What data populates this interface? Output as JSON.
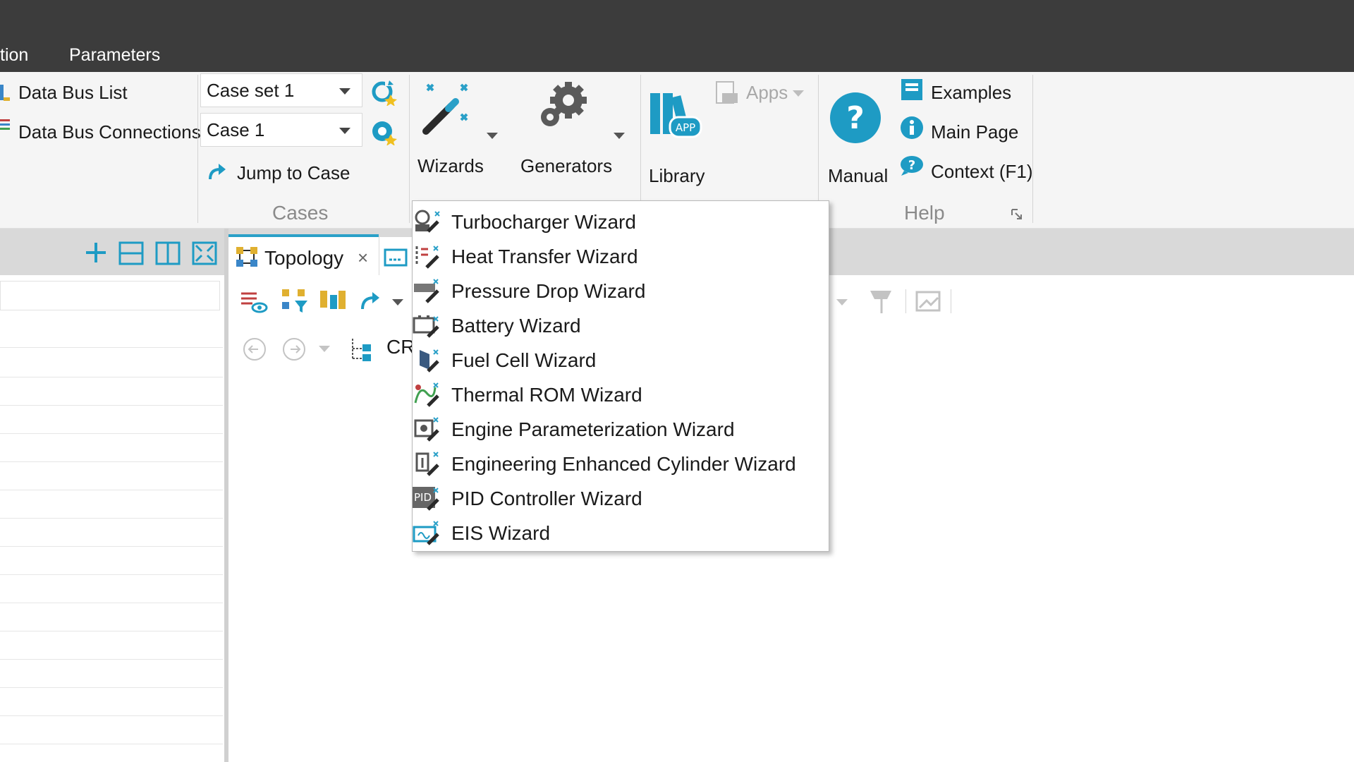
{
  "menubar": {
    "items": [
      "tion",
      "Parameters"
    ]
  },
  "ribbon": {
    "data_bus_list": "Data Bus List",
    "data_bus_connections": "Data Bus Connections",
    "case_set_value": "Case set 1",
    "case_value": "Case 1",
    "jump_to_case": "Jump to Case",
    "cases_group": "Cases",
    "wizards_label": "Wizards",
    "generators_label": "Generators",
    "library_label": "Library",
    "apps_label": "Apps",
    "manual_label": "Manual",
    "examples_label": "Examples",
    "main_page_label": "Main Page",
    "context_label": "Context (F1)",
    "help_group": "Help"
  },
  "document": {
    "tab_label": "Topology",
    "tab_close": "×",
    "toolbar_text": "CR"
  },
  "wizard_menu": {
    "items": [
      {
        "label": "Turbocharger Wizard",
        "icon": "turbocharger-wizard-icon"
      },
      {
        "label": "Heat Transfer Wizard",
        "icon": "heat-transfer-wizard-icon"
      },
      {
        "label": "Pressure Drop Wizard",
        "icon": "pressure-drop-wizard-icon"
      },
      {
        "label": "Battery Wizard",
        "icon": "battery-wizard-icon"
      },
      {
        "label": "Fuel Cell Wizard",
        "icon": "fuel-cell-wizard-icon"
      },
      {
        "label": "Thermal ROM Wizard",
        "icon": "thermal-rom-wizard-icon"
      },
      {
        "label": "Engine Parameterization Wizard",
        "icon": "engine-parameterization-wizard-icon"
      },
      {
        "label": "Engineering Enhanced Cylinder Wizard",
        "icon": "enhanced-cylinder-wizard-icon"
      },
      {
        "label": "PID Controller Wizard",
        "icon": "pid-controller-wizard-icon"
      },
      {
        "label": "EIS Wizard",
        "icon": "eis-wizard-icon"
      }
    ],
    "pid_icon_text": "PID"
  },
  "colors": {
    "accent": "#2aa0c8",
    "help_blue": "#1e9bc4",
    "titlebar": "#3c3c3c",
    "ribbon_bg": "#f5f5f5"
  }
}
